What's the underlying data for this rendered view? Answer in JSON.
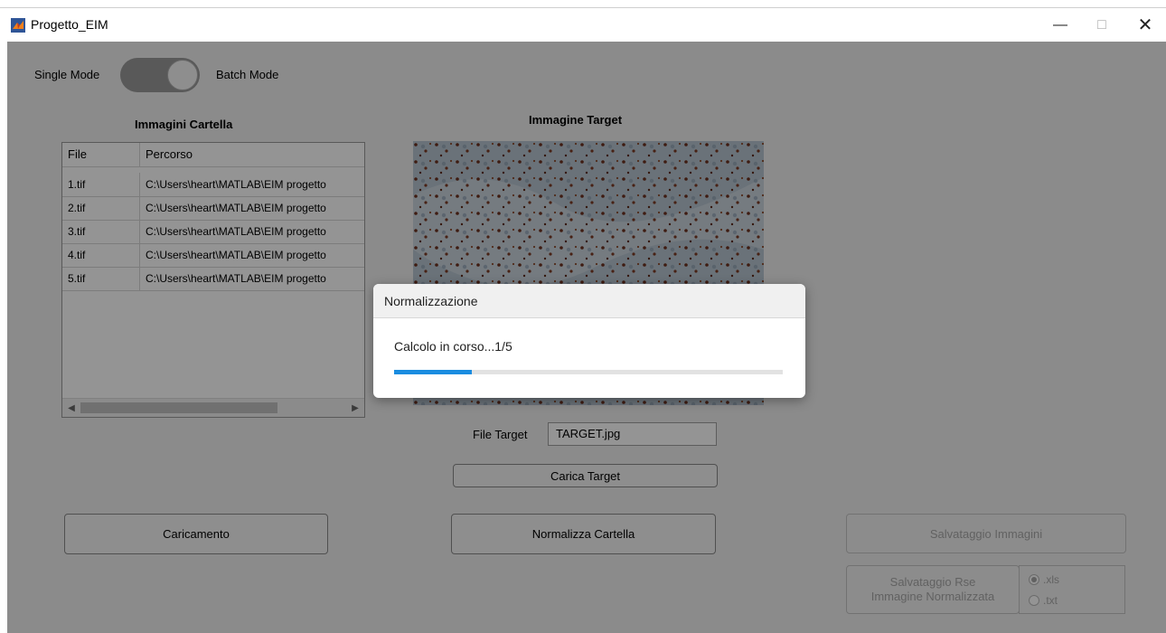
{
  "window": {
    "title": "Progetto_EIM"
  },
  "mode_switch": {
    "left_label": "Single Mode",
    "right_label": "Batch Mode"
  },
  "folder_section": {
    "title": "Immagini Cartella",
    "table": {
      "columns": [
        "File",
        "Percorso"
      ],
      "rows": [
        [
          "1.tif",
          "C:\\Users\\heart\\MATLAB\\EIM progetto"
        ],
        [
          "2.tif",
          "C:\\Users\\heart\\MATLAB\\EIM progetto"
        ],
        [
          "3.tif",
          "C:\\Users\\heart\\MATLAB\\EIM progetto"
        ],
        [
          "4.tif",
          "C:\\Users\\heart\\MATLAB\\EIM progetto"
        ],
        [
          "5.tif",
          "C:\\Users\\heart\\MATLAB\\EIM progetto"
        ]
      ]
    }
  },
  "target_section": {
    "title": "Immagine Target",
    "file_label": "File Target",
    "file_value": "TARGET.jpg",
    "load_button": "Carica Target"
  },
  "buttons": {
    "caricamento": "Caricamento",
    "normalizza": "Normalizza Cartella",
    "salvataggio_immagini": "Salvataggio Immagini",
    "salvataggio_rse": "Salvataggio Rse\nImmagine Normalizzata"
  },
  "save_format": {
    "options": [
      ".xls",
      ".txt"
    ],
    "selected": ".xls"
  },
  "progress_dialog": {
    "title": "Normalizzazione",
    "message": "Calcolo in corso...1/5",
    "progress_fraction": 0.2
  },
  "colors": {
    "progress_fill": "#1a8ce0",
    "app_background": "#f0f0f0"
  }
}
